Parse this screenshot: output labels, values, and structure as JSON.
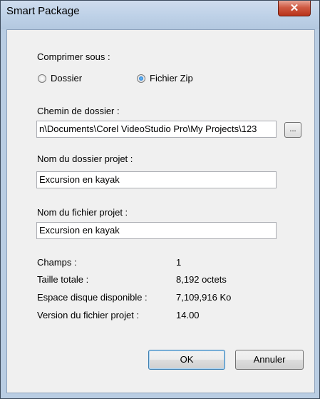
{
  "window": {
    "title": "Smart Package"
  },
  "compress": {
    "label": "Comprimer sous :",
    "options": [
      {
        "label": "Dossier",
        "selected": false
      },
      {
        "label": "Fichier Zip",
        "selected": true
      }
    ]
  },
  "folder_path": {
    "label": "Chemin de dossier :",
    "value": "n\\Documents\\Corel VideoStudio Pro\\My Projects\\123",
    "browse_label": "..."
  },
  "project_folder": {
    "label": "Nom du dossier projet :",
    "value": "Excursion en kayak"
  },
  "project_file": {
    "label": "Nom du fichier projet :",
    "value": "Excursion en kayak"
  },
  "info": [
    {
      "label": "Champs :",
      "value": "1"
    },
    {
      "label": "Taille totale :",
      "value": "8,192 octets"
    },
    {
      "label": "Espace disque disponible :",
      "value": "7,109,916 Ko"
    },
    {
      "label": "Version du fichier projet :",
      "value": "14.00"
    }
  ],
  "buttons": {
    "ok": "OK",
    "cancel": "Annuler"
  },
  "colors": {
    "close_button": "#c8452c",
    "default_button_border": "#3c7fb1"
  }
}
